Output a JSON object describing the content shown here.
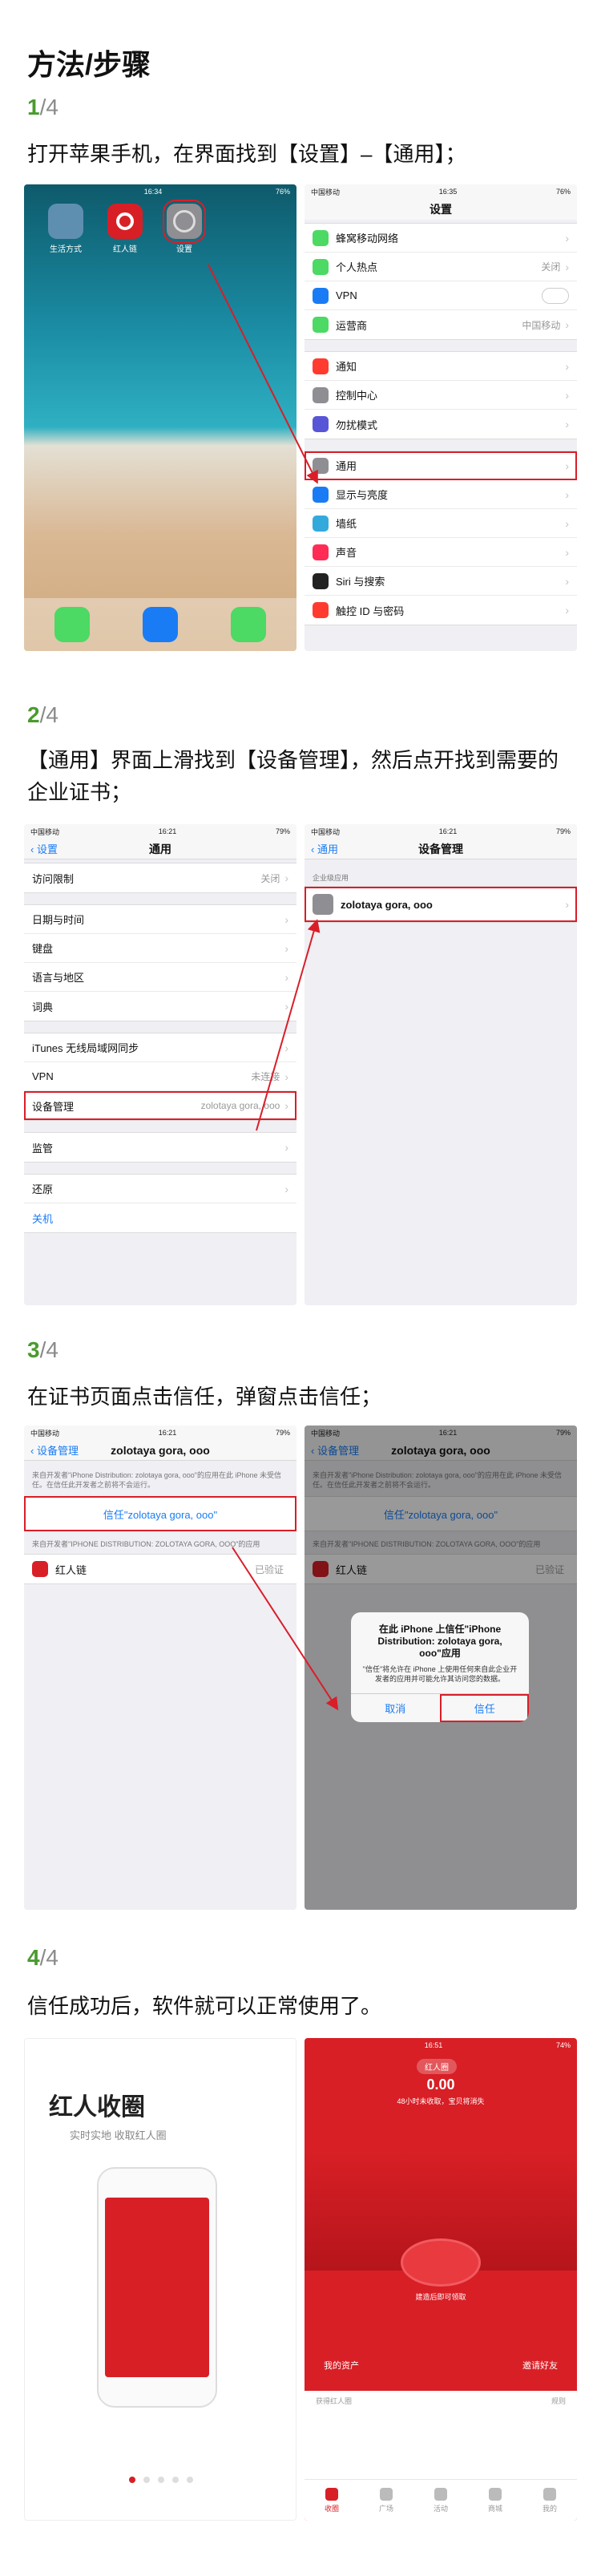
{
  "title": "方法/步骤",
  "steps": [
    {
      "num": "1",
      "total": "/4",
      "desc": "打开苹果手机，在界面找到【设置】–【通用】；"
    },
    {
      "num": "2",
      "total": "/4",
      "desc": "【通用】界面上滑找到【设备管理】，然后点开找到需要的企业证书；"
    },
    {
      "num": "3",
      "total": "/4",
      "desc": "在证书页面点击信任，弹窗点击信任；"
    },
    {
      "num": "4",
      "total": "/4",
      "desc": "信任成功后，软件就可以正常使用了。"
    }
  ],
  "s1": {
    "home_status": {
      "left": "",
      "time": "16:34",
      "right": "76%"
    },
    "apps": [
      "生活方式",
      "红人链",
      "设置"
    ],
    "settings_status": {
      "left": "中国移动",
      "time": "16:35",
      "right": "76%"
    },
    "settings_title": "设置",
    "group1": [
      {
        "label": "蜂窝移动网络",
        "value": "",
        "color": "#4cd964"
      },
      {
        "label": "个人热点",
        "value": "关闭",
        "color": "#4cd964"
      },
      {
        "label": "VPN",
        "value": "",
        "color": "#1a7cf5"
      },
      {
        "label": "运营商",
        "value": "中国移动",
        "color": "#4cd964"
      }
    ],
    "group2": [
      {
        "label": "通知",
        "color": "#ff3b30"
      },
      {
        "label": "控制中心",
        "color": "#8e8e93"
      },
      {
        "label": "勿扰模式",
        "color": "#5856d6"
      }
    ],
    "group3": [
      {
        "label": "通用",
        "color": "#8e8e93"
      },
      {
        "label": "显示与亮度",
        "color": "#1a7cf5"
      },
      {
        "label": "墙纸",
        "color": "#34aadc"
      },
      {
        "label": "声音",
        "color": "#ff2d55"
      },
      {
        "label": "Siri 与搜索",
        "color": "#222222"
      },
      {
        "label": "触控 ID 与密码",
        "color": "#ff3b30"
      }
    ]
  },
  "s2": {
    "left_status": {
      "left": "中国移动",
      "time": "16:21",
      "right": "79%"
    },
    "left_back": "设置",
    "left_title": "通用",
    "rows": [
      {
        "label": "访问限制",
        "value": "关闭"
      },
      {
        "label": "日期与时间",
        "value": ""
      },
      {
        "label": "键盘",
        "value": ""
      },
      {
        "label": "语言与地区",
        "value": ""
      },
      {
        "label": "词典",
        "value": ""
      },
      {
        "label": "iTunes 无线局域网同步",
        "value": ""
      },
      {
        "label": "VPN",
        "value": "未连接"
      },
      {
        "label": "设备管理",
        "value": "zolotaya gora, ooo"
      },
      {
        "label": "监管",
        "value": ""
      },
      {
        "label": "还原",
        "value": ""
      },
      {
        "label": "关机",
        "value": ""
      }
    ],
    "right_status": {
      "left": "中国移动",
      "time": "16:21",
      "right": "79%"
    },
    "right_back": "通用",
    "right_title": "设备管理",
    "section": "企业级应用",
    "profile": "zolotaya gora, ooo"
  },
  "s3": {
    "status": {
      "left": "中国移动",
      "time": "16:21",
      "right": "79%"
    },
    "back": "设备管理",
    "title": "zolotaya gora, ooo",
    "info": "来自开发者\"iPhone Distribution: zolotaya gora, ooo\"的应用在此 iPhone 未受信任。在信任此开发者之前将不会运行。",
    "trust_link": "信任\"zolotaya gora, ooo\"",
    "section": "来自开发者\"IPHONE DISTRIBUTION: ZOLOTAYA GORA, OOO\"的应用",
    "app_name": "红人链",
    "app_status": "已验证",
    "alert_title": "在此 iPhone 上信任\"iPhone Distribution: zolotaya gora, ooo\"应用",
    "alert_msg": "\"信任\"将允许在 iPhone 上使用任何来自此企业开发者的应用并可能允许其访问您的数据。",
    "cancel": "取消",
    "trust": "信任"
  },
  "s4": {
    "brand": "红人收圈",
    "slogan": "实时实地 收取红人圈",
    "status": {
      "left": "",
      "time": "16:51",
      "right": "74%"
    },
    "badge": "红人圈",
    "amount": "0.00",
    "sub": "48小时未收取，宝贝将消失",
    "assets": "我的资产",
    "invite": "邀请好友",
    "footer_left": "获得红人圈",
    "footer_right": "规则",
    "tabs": [
      "收圈",
      "广场",
      "活动",
      "商城",
      "我的"
    ],
    "center_text": "建造后即可领取"
  },
  "colors": {
    "accent_green": "#4a9b2d",
    "brand_red": "#d81f26",
    "ios_blue": "#1a7cf5",
    "highlight_red": "#d91e28"
  }
}
